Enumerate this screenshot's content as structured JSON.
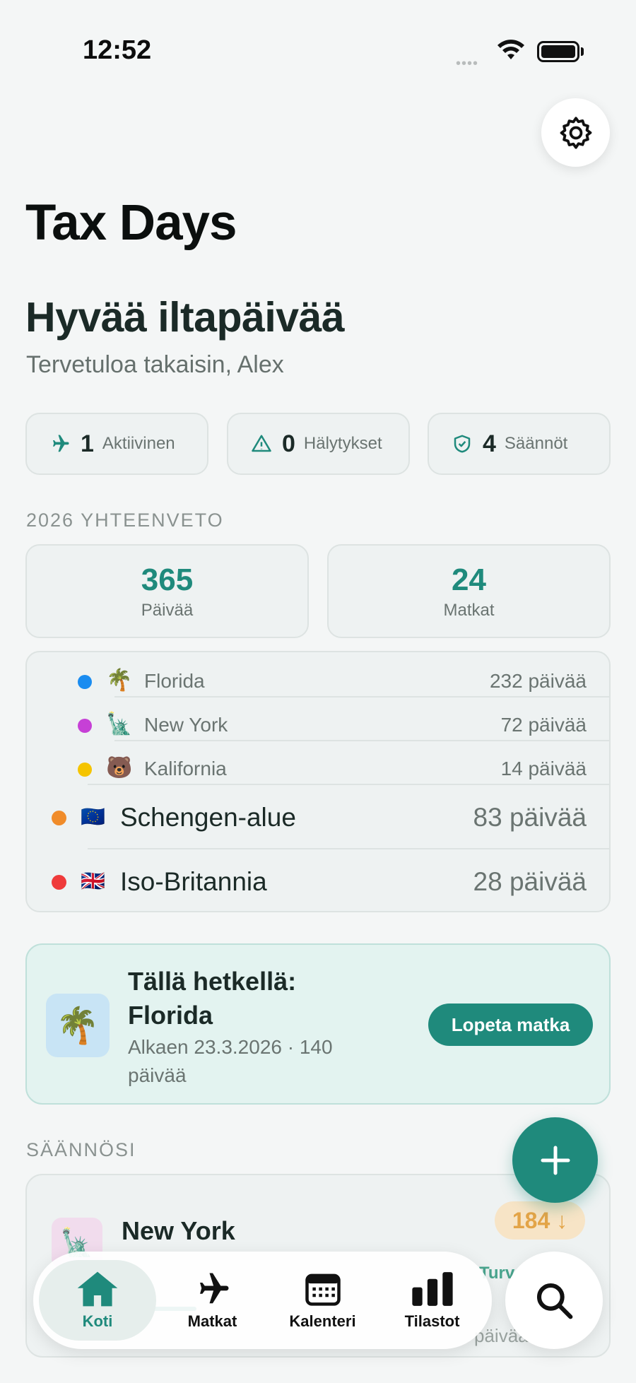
{
  "status_bar": {
    "time": "12:52"
  },
  "header": {
    "title": "Tax Days"
  },
  "greeting": {
    "title": "Hyvää iltapäivää",
    "subtitle": "Tervetuloa takaisin, Alex"
  },
  "pills": [
    {
      "value": "1",
      "label": "Aktiivinen",
      "icon": "airplane-icon"
    },
    {
      "value": "0",
      "label": "Hälytykset",
      "icon": "warning-icon"
    },
    {
      "value": "4",
      "label": "Säännöt",
      "icon": "shield-icon"
    }
  ],
  "summary": {
    "section_label": "2026 YHTEENVETO",
    "days_value": "365",
    "days_label": "Päivää",
    "trips_value": "24",
    "trips_label": "Matkat"
  },
  "regions": [
    {
      "emoji": "🌴",
      "name": "Florida",
      "value": "232 päivää",
      "color": "#1a8cf0"
    },
    {
      "emoji": "🗽",
      "name": "New York",
      "value": "72 päivää",
      "color": "#c640d6"
    },
    {
      "emoji": "🐻",
      "name": "Kalifornia",
      "value": "14 päivää",
      "color": "#f5c400"
    },
    {
      "emoji": "🇪🇺",
      "name": "Schengen-alue",
      "value": "83 päivää",
      "color": "#f08c2a"
    },
    {
      "emoji": "🇬🇧",
      "name": "Iso-Britannia",
      "value": "28 päivää",
      "color": "#ef3b3b"
    }
  ],
  "current": {
    "emoji": "🌴",
    "title": "Tällä hetkellä: Florida",
    "subtitle": "Alkaen 23.3.2026 · 140 päivää",
    "button": "Lopeta matka"
  },
  "rules": {
    "section_label": "SÄÄNNÖSI",
    "item": {
      "emoji": "🗽",
      "name": "New York",
      "badge": "184 ↓",
      "status": "Turva",
      "days": "päivää"
    }
  },
  "tabbar": {
    "tabs": [
      {
        "label": "Koti",
        "icon": "home-icon"
      },
      {
        "label": "Matkat",
        "icon": "airplane-icon"
      },
      {
        "label": "Kalenteri",
        "icon": "calendar-icon"
      },
      {
        "label": "Tilastot",
        "icon": "chart-icon"
      }
    ]
  },
  "colors": {
    "accent": "#1f8a7c",
    "background": "#f4f6f6",
    "warning": "#e3a447"
  }
}
